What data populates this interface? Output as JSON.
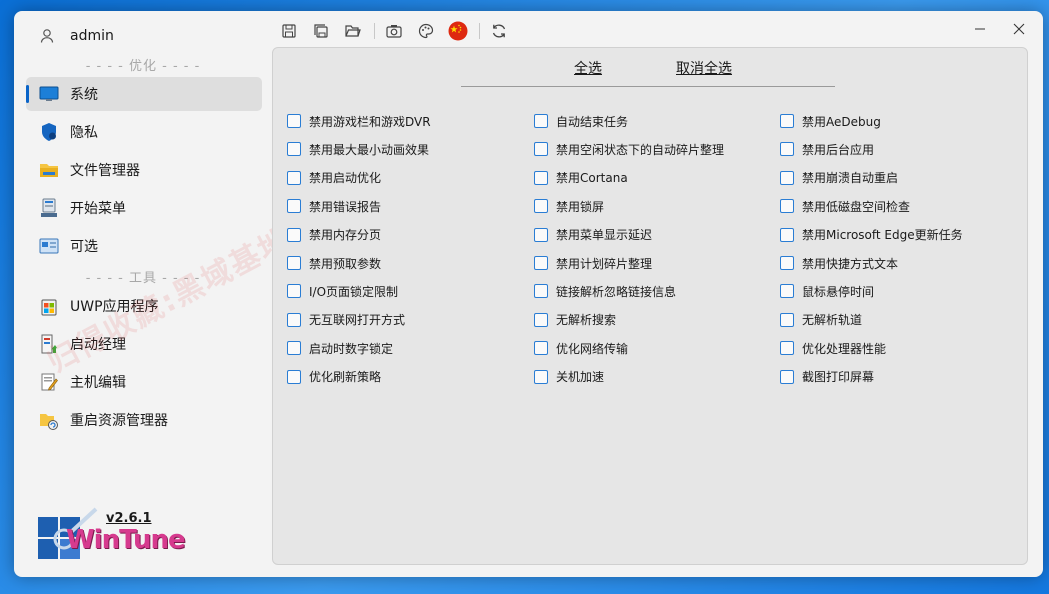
{
  "user": {
    "name": "admin"
  },
  "sidebar": {
    "group1": "- - - - 优化 - - - -",
    "group2": "- - - - 工具 - - - -",
    "items": [
      {
        "label": "系统"
      },
      {
        "label": "隐私"
      },
      {
        "label": "文件管理器"
      },
      {
        "label": "开始菜单"
      },
      {
        "label": "可选"
      },
      {
        "label": "UWP应用程序"
      },
      {
        "label": "启动经理"
      },
      {
        "label": "主机编辑"
      },
      {
        "label": "重启资源管理器"
      }
    ],
    "watermark": "归得收藏:黑域基地 Hybase",
    "version": "v2.6.1",
    "logo_text": "WinTune"
  },
  "toolbar": {
    "icons": [
      "save-icon",
      "save-all-icon",
      "open-folder-icon",
      "screenshot-icon",
      "palette-icon",
      "china-flag-icon",
      "refresh-icon"
    ]
  },
  "main": {
    "select_all": "全选",
    "deselect_all": "取消全选",
    "col1": [
      "禁用游戏栏和游戏DVR",
      "禁用最大最小动画效果",
      "禁用启动优化",
      "禁用错误报告",
      "禁用内存分页",
      "禁用预取参数",
      "I/O页面锁定限制",
      "无互联网打开方式",
      "启动时数字锁定",
      "优化刷新策略"
    ],
    "col2": [
      "自动结束任务",
      "禁用空闲状态下的自动碎片整理",
      "禁用Cortana",
      "禁用锁屏",
      "禁用菜单显示延迟",
      "禁用计划碎片整理",
      "链接解析忽略链接信息",
      "无解析搜索",
      "优化网络传输",
      "关机加速"
    ],
    "col3": [
      "禁用AeDebug",
      "禁用后台应用",
      "禁用崩溃自动重启",
      "禁用低磁盘空间检查",
      "禁用Microsoft Edge更新任务",
      "禁用快捷方式文本",
      "鼠标悬停时间",
      "无解析轨道",
      "优化处理器性能",
      "截图打印屏幕"
    ]
  },
  "colors": {
    "accent": "#2a7dd4",
    "panel": "#e6e6e6",
    "active": "#dedede"
  }
}
